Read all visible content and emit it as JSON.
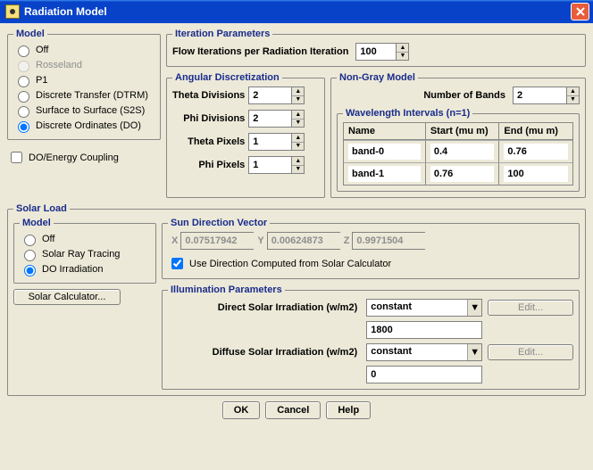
{
  "window": {
    "title": "Radiation Model"
  },
  "model": {
    "legend": "Model",
    "options": {
      "off": "Off",
      "rosseland": "Rosseland",
      "p1": "P1",
      "dtrm": "Discrete Transfer (DTRM)",
      "s2s": "Surface to Surface (S2S)",
      "do": "Discrete Ordinates (DO)"
    },
    "do_coupling": "DO/Energy Coupling"
  },
  "iter": {
    "legend": "Iteration Parameters",
    "flow_per_rad_label": "Flow Iterations per Radiation Iteration",
    "flow_per_rad_value": "100"
  },
  "ang": {
    "legend": "Angular Discretization",
    "theta_div_label": "Theta Divisions",
    "theta_div_value": "2",
    "phi_div_label": "Phi Divisions",
    "phi_div_value": "2",
    "theta_pix_label": "Theta Pixels",
    "theta_pix_value": "1",
    "phi_pix_label": "Phi Pixels",
    "phi_pix_value": "1"
  },
  "ngray": {
    "legend": "Non-Gray Model",
    "bands_label": "Number of Bands",
    "bands_value": "2",
    "wl_legend": "Wavelength Intervals (n=1)",
    "cols": {
      "name": "Name",
      "start": "Start (mu m)",
      "end": "End (mu m)"
    },
    "rows": [
      {
        "name": "band-0",
        "start": "0.4",
        "end": "0.76"
      },
      {
        "name": "band-1",
        "start": "0.76",
        "end": "100"
      }
    ]
  },
  "solar": {
    "legend": "Solar Load",
    "model_legend": "Model",
    "options": {
      "off": "Off",
      "srt": "Solar Ray Tracing",
      "doi": "DO Irradiation"
    },
    "calc_btn": "Solar Calculator...",
    "sdv": {
      "legend": "Sun Direction Vector",
      "x_lbl": "X",
      "x": "0.07517942",
      "y_lbl": "Y",
      "y": "0.00624873",
      "z_lbl": "Z",
      "z": "0.9971504",
      "use_calc": "Use Direction Computed from Solar Calculator"
    },
    "illum": {
      "legend": "Illumination Parameters",
      "direct_label": "Direct Solar Irradiation (w/m2)",
      "direct_type": "constant",
      "direct_value": "1800",
      "diffuse_label": "Diffuse Solar Irradiation (w/m2)",
      "diffuse_type": "constant",
      "diffuse_value": "0",
      "edit": "Edit..."
    }
  },
  "buttons": {
    "ok": "OK",
    "cancel": "Cancel",
    "help": "Help"
  }
}
